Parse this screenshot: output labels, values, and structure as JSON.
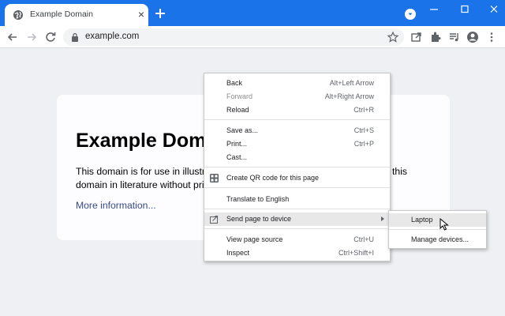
{
  "browser": {
    "tab": {
      "title": "Example Domain",
      "favicon": "globe-icon"
    },
    "new_tab_icon": "plus-icon",
    "url": "example.com",
    "accent_color": "#1a73e8"
  },
  "page": {
    "heading": "Example Domain",
    "paragraph": "This domain is for use in illustrative examples in documents. You may use this domain in literature without prior coordination or asking for permission.",
    "link": "More information..."
  },
  "context_menu": {
    "back": {
      "label": "Back",
      "shortcut": "Alt+Left Arrow"
    },
    "forward": {
      "label": "Forward",
      "shortcut": "Alt+Right Arrow"
    },
    "reload": {
      "label": "Reload",
      "shortcut": "Ctrl+R"
    },
    "save_as": {
      "label": "Save as...",
      "shortcut": "Ctrl+S"
    },
    "print": {
      "label": "Print...",
      "shortcut": "Ctrl+P"
    },
    "cast": {
      "label": "Cast..."
    },
    "qr": {
      "label": "Create QR code for this page"
    },
    "translate": {
      "label": "Translate to English"
    },
    "send": {
      "label": "Send page to device"
    },
    "view_source": {
      "label": "View page source",
      "shortcut": "Ctrl+U"
    },
    "inspect": {
      "label": "Inspect",
      "shortcut": "Ctrl+Shift+I"
    }
  },
  "submenu": {
    "laptop": "Laptop",
    "manage": "Manage devices..."
  }
}
